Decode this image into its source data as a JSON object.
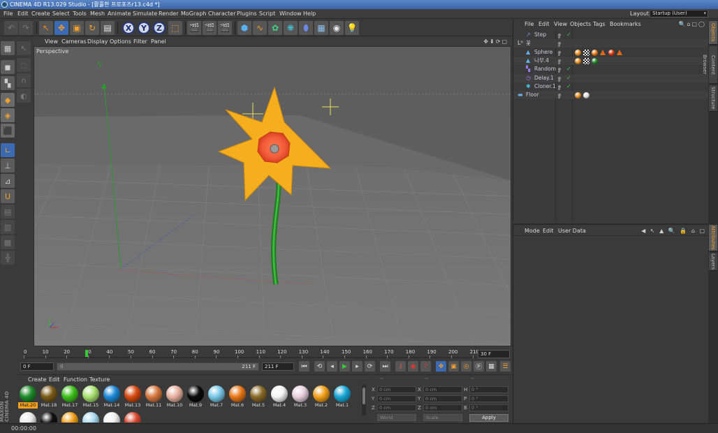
{
  "window": {
    "title": "CINEMA 4D R13.029 Studio - [활홀한 프로포즈r13.c4d *]"
  },
  "menubar": {
    "items": [
      "File",
      "Edit",
      "Create",
      "Select",
      "Tools",
      "Mesh",
      "Animate",
      "Simulate",
      "Render",
      "MoGraph",
      "Character",
      "Plugins",
      "Script",
      "Window",
      "Help"
    ],
    "layout_label": "Layout:",
    "layout_value": "Startup (User)"
  },
  "viewport": {
    "menu": [
      "View",
      "Cameras",
      "Display",
      "Options",
      "Filter",
      "Panel"
    ],
    "label": "Perspective",
    "axis_label": "Y"
  },
  "timeline": {
    "ticks": [
      "0",
      "10",
      "20",
      "30",
      "40",
      "50",
      "60",
      "70",
      "80",
      "90",
      "100",
      "110",
      "120",
      "130",
      "140",
      "150",
      "160",
      "170",
      "180",
      "190",
      "200",
      "210"
    ],
    "end_frame": "30 F"
  },
  "transport": {
    "current_frame": "0 F",
    "range_start": "0",
    "range_end": "211 F",
    "max_frame": "211 F"
  },
  "materials": {
    "menu": [
      "Create",
      "Edit",
      "Function",
      "Texture"
    ],
    "items": [
      {
        "label": "Mat.20",
        "color": "#1f8a2a",
        "selected": true
      },
      {
        "label": "Mat.18",
        "color": "#7a5a18"
      },
      {
        "label": "Mat.17",
        "color": "#3cc01c"
      },
      {
        "label": "Mat.15",
        "color": "#a8e070"
      },
      {
        "label": "Mat.14",
        "color": "#1e8ad6"
      },
      {
        "label": "Mat.13",
        "color": "#d84a10"
      },
      {
        "label": "Mat.11",
        "color": "#d87840"
      },
      {
        "label": "Mat.10",
        "color": "#e8b0a0"
      },
      {
        "label": "Mat.9",
        "color": "#0a0a0a"
      },
      {
        "label": "Mat.7",
        "color": "#78c8e8"
      },
      {
        "label": "Mat.6",
        "color": "#e87818"
      },
      {
        "label": "Mat.5",
        "color": "#8a6a28"
      },
      {
        "label": "Mat.4",
        "color": "#f4f4f4"
      },
      {
        "label": "Mat.3",
        "color": "#e8d0e0"
      },
      {
        "label": "Mat.2",
        "color": "#f0a018"
      },
      {
        "label": "Mat.1",
        "color": "#18a8d8"
      }
    ],
    "second_row": [
      "#e8e8e8",
      "#111111",
      "#f0a018",
      "#a8d8f0",
      "#eeeeee",
      "#d84a30"
    ]
  },
  "coords": {
    "header_left": "--",
    "header_mid": "--",
    "header_right": "--",
    "rows": [
      {
        "a": "X",
        "av": "0 cm",
        "b": "X",
        "bv": "0 cm",
        "c": "H",
        "cv": "0 °"
      },
      {
        "a": "Y",
        "av": "0 cm",
        "b": "Y",
        "bv": "0 cm",
        "c": "P",
        "cv": "0 °"
      },
      {
        "a": "Z",
        "av": "0 cm",
        "b": "Z",
        "bv": "0 cm",
        "c": "B",
        "cv": "0 °"
      }
    ],
    "mode": "World",
    "size_mode": "Scale",
    "apply": "Apply"
  },
  "status": {
    "text": "00:00:00"
  },
  "object_manager": {
    "menu": [
      "File",
      "Edit",
      "View",
      "Objects",
      "Tags",
      "Bookmarks"
    ],
    "objects": [
      {
        "name": "Step",
        "indent": 1,
        "icon": "step-icon",
        "glyph": "↗",
        "color": "#6a9ae8",
        "check": true,
        "tags": []
      },
      {
        "name": "꽃",
        "indent": 0,
        "icon": "null-icon",
        "glyph": "L⁰",
        "color": "#ddd",
        "check": false,
        "tags": []
      },
      {
        "name": "Sphere",
        "indent": 1,
        "icon": "sphere-icon",
        "glyph": "▲",
        "color": "#6ab0e8",
        "check": false,
        "tags": [
          "#e89020",
          "chk",
          "#e87818",
          "tri",
          "#d83a10",
          "tri"
        ]
      },
      {
        "name": "나무.4",
        "indent": 1,
        "icon": "tree-icon",
        "glyph": "▲",
        "color": "#6ab0e8",
        "check": false,
        "tags": [
          "#e89020",
          "chk",
          "#1f8a2a"
        ]
      },
      {
        "name": "Random",
        "indent": 1,
        "icon": "random-icon",
        "glyph": "▚",
        "color": "#9a7ae8",
        "check": true,
        "tags": []
      },
      {
        "name": "Delay.1",
        "indent": 1,
        "icon": "delay-icon",
        "glyph": "◷",
        "color": "#9a7ae8",
        "check": true,
        "tags": []
      },
      {
        "name": "Cloner.1",
        "indent": 1,
        "icon": "cloner-icon",
        "glyph": "✱",
        "color": "#4ac0e0",
        "check": true,
        "tags": []
      },
      {
        "name": "Floor",
        "indent": 0,
        "icon": "floor-icon",
        "glyph": "▬",
        "color": "#6ab0e8",
        "check": false,
        "tags": [
          "#e89020",
          "#dddddd"
        ]
      }
    ]
  },
  "attribute_manager": {
    "menu": [
      "Mode",
      "Edit",
      "User Data"
    ]
  },
  "side_tabs": [
    "Objects",
    "Content Browser",
    "Structure",
    "Attributes",
    "Layers"
  ],
  "brand": "MAXON CINEMA 4D"
}
